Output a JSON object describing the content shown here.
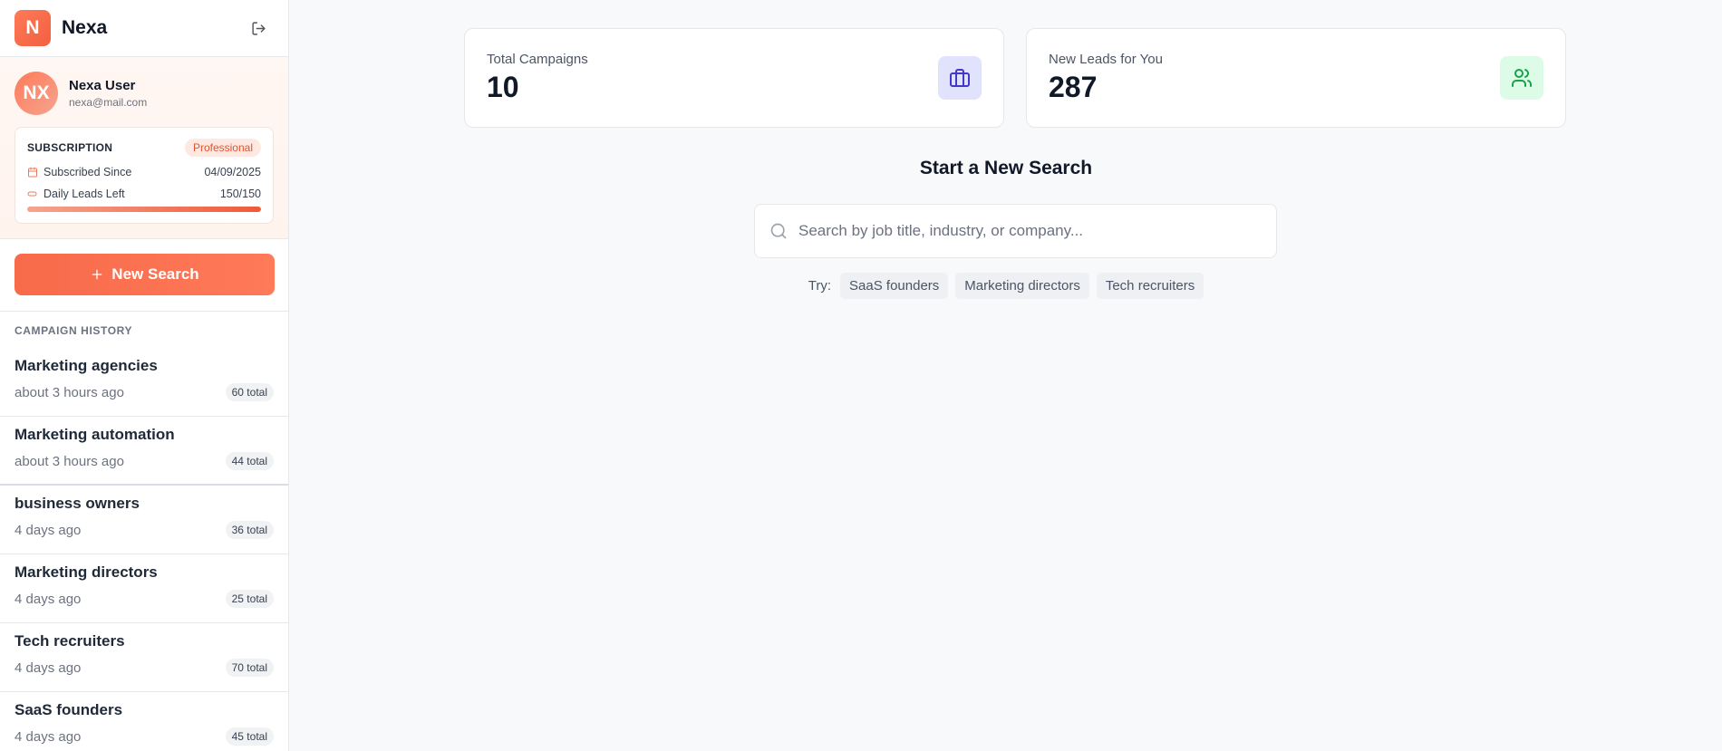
{
  "app": {
    "logo_letter": "N",
    "name": "Nexa"
  },
  "user": {
    "initials": "NX",
    "name": "Nexa User",
    "email": "nexa@mail.com"
  },
  "subscription": {
    "title": "SUBSCRIPTION",
    "plan": "Professional",
    "since_label": "Subscribed Since",
    "since_value": "04/09/2025",
    "leads_label": "Daily Leads Left",
    "leads_value": "150/150",
    "leads_fraction": 1.0
  },
  "new_search_label": "New Search",
  "history": {
    "title": "CAMPAIGN HISTORY",
    "items": [
      {
        "title": "Marketing agencies",
        "time": "about 3 hours ago",
        "badge": "60 total"
      },
      {
        "title": "Marketing automation",
        "time": "about 3 hours ago",
        "badge": "44 total"
      },
      {
        "title": "business owners",
        "time": "4 days ago",
        "badge": "36 total"
      },
      {
        "title": "Marketing directors",
        "time": "4 days ago",
        "badge": "25 total"
      },
      {
        "title": "Tech recruiters",
        "time": "4 days ago",
        "badge": "70 total"
      },
      {
        "title": "SaaS founders",
        "time": "4 days ago",
        "badge": "45 total"
      }
    ]
  },
  "stats": {
    "campaigns": {
      "label": "Total Campaigns",
      "value": "10",
      "icon": "briefcase-icon",
      "color": "#4338ca"
    },
    "leads": {
      "label": "New Leads for You",
      "value": "287",
      "icon": "users-icon",
      "color": "#16a34a"
    }
  },
  "search": {
    "title": "Start a New Search",
    "placeholder": "Search by job title, industry, or company...",
    "value": "",
    "try_label": "Try:",
    "suggestions": [
      "SaaS founders",
      "Marketing directors",
      "Tech recruiters"
    ]
  },
  "colors": {
    "accent": "#f76a4a",
    "background": "#f8f9fb"
  }
}
